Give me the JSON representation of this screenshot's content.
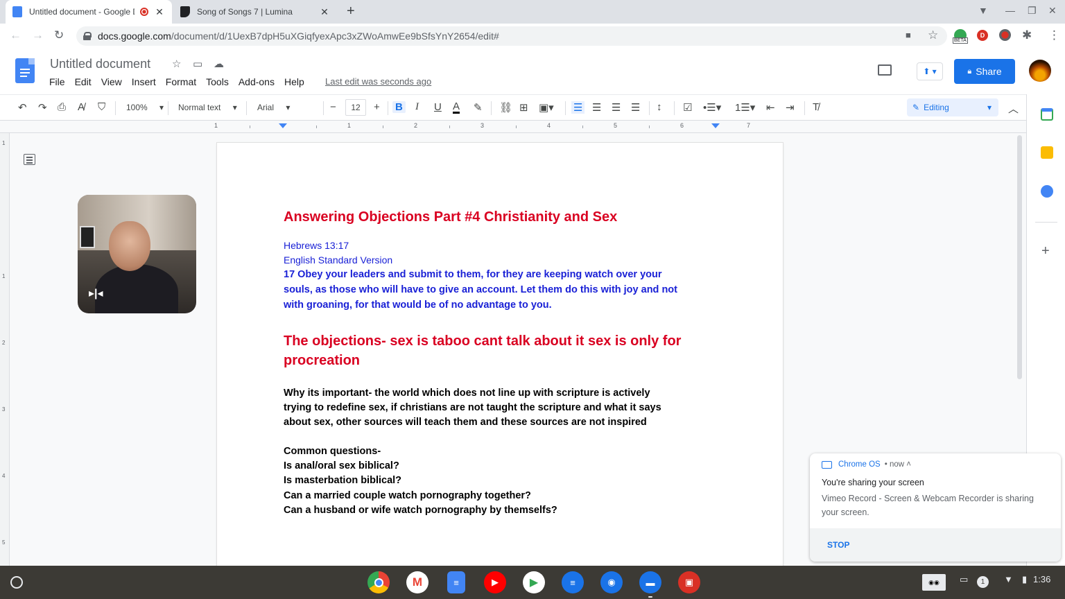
{
  "browser": {
    "tabs": [
      {
        "title": "Untitled document - Google Docs",
        "active": true
      },
      {
        "title": "Song of Songs 7 | Lumina",
        "active": false
      }
    ],
    "url_host": "docs.google.com",
    "url_path": "/document/d/1UexB7dpH5uXGiqfyexApc3xZWoAmwEe9bSfsYnY2654/edit#",
    "ext_beta_label": "BETA",
    "ext_d_label": "D"
  },
  "docs": {
    "title": "Untitled document",
    "menu": [
      "File",
      "Edit",
      "View",
      "Insert",
      "Format",
      "Tools",
      "Add-ons",
      "Help"
    ],
    "last_edit": "Last edit was seconds ago",
    "share_label": "Share"
  },
  "toolbar": {
    "zoom": "100%",
    "style": "Normal text",
    "font": "Arial",
    "font_size": "12",
    "mode": "Editing"
  },
  "ruler": {
    "marks": [
      "1",
      "1",
      "2",
      "3",
      "4",
      "5",
      "6",
      "7"
    ],
    "vmarks": [
      "1",
      "1",
      "2",
      "3",
      "4",
      "5"
    ]
  },
  "document": {
    "heading1": "Answering Objections Part #4 Christianity and Sex",
    "verse_ref": "Hebrews 13:17",
    "version": "English Standard Version",
    "verse_lines": [
      "17 Obey your leaders and submit to them, for they are keeping watch over your",
      "souls, as those who will have to give an account. Let them do this with joy and not",
      "with groaning, for that would be of no advantage to you."
    ],
    "heading2_lines": [
      "The objections- sex is taboo cant talk about it sex is only for",
      "procreation"
    ],
    "why_lines": [
      "Why its important- the world which does not line up with scripture is actively",
      "trying to redefine sex, if christians are not taught the scripture and what it says",
      "about sex, other sources will teach them and these sources are not inspired"
    ],
    "questions_header": "Common questions-",
    "questions": [
      "Is anal/oral sex biblical?",
      "Is masterbation biblical?",
      "Can a married couple watch pornography together?",
      "Can a husband or wife watch pornography by themselfs?"
    ]
  },
  "notification": {
    "source": "Chrome OS",
    "time": "• now ˄",
    "title": "You're sharing your screen",
    "body": "Vimeo Record - Screen & Webcam Recorder is sharing your screen.",
    "action": "STOP"
  },
  "shelf": {
    "tray_badge": "1",
    "time": "1:36"
  },
  "colors": {
    "accent": "#1a73e8",
    "heading_red": "#d90021",
    "verse_blue": "#1a21d6"
  }
}
